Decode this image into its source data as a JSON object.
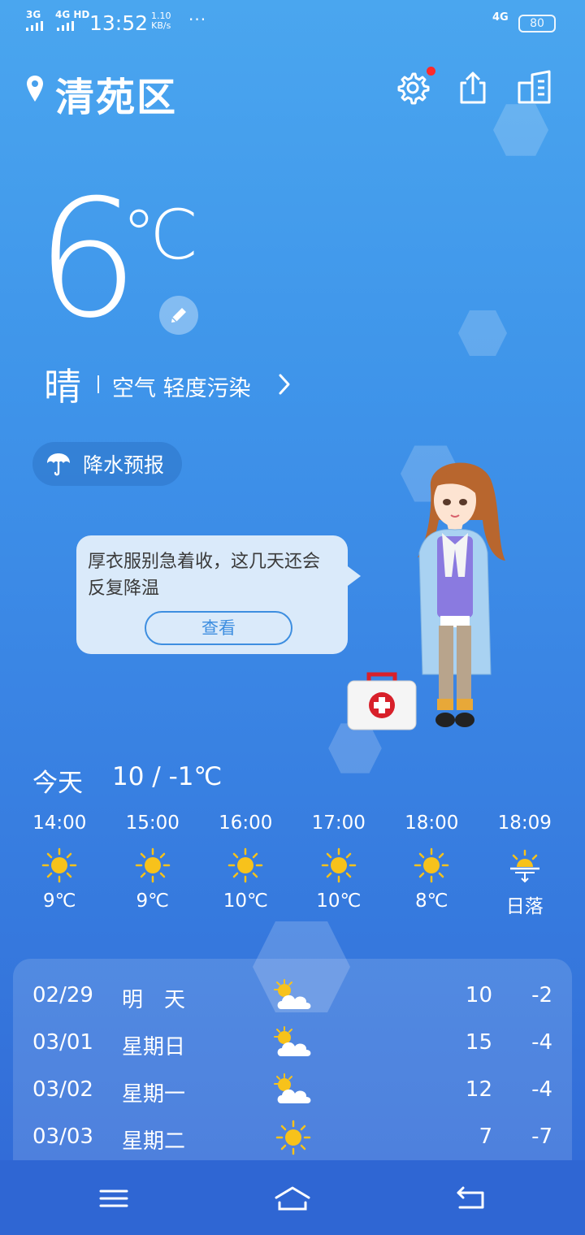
{
  "status_bar": {
    "signal1": "3G",
    "signal2": "4G HD",
    "time": "13:52",
    "speed_value": "1.10",
    "speed_unit": "KB/s",
    "more": "···",
    "network": "4G",
    "battery": "80"
  },
  "header": {
    "location": "清苑区",
    "settings_icon": "gear-icon",
    "share_icon": "share-icon",
    "cities_icon": "buildings-icon"
  },
  "current": {
    "temperature": "6",
    "unit": "℃",
    "condition": "晴",
    "air_quality": "空气 轻度污染"
  },
  "rain_button": {
    "label": "降水预报"
  },
  "tip": {
    "text": "厚衣服别急着收，这几天还会反复降温",
    "button": "查看"
  },
  "today": {
    "label": "今天",
    "range": "10 / -1℃"
  },
  "hourly": [
    {
      "time": "14:00",
      "icon": "sun-icon",
      "value": "9℃"
    },
    {
      "time": "15:00",
      "icon": "sun-icon",
      "value": "9℃"
    },
    {
      "time": "16:00",
      "icon": "sun-icon",
      "value": "10℃"
    },
    {
      "time": "17:00",
      "icon": "sun-icon",
      "value": "10℃"
    },
    {
      "time": "18:00",
      "icon": "sun-icon",
      "value": "8℃"
    },
    {
      "time": "18:09",
      "icon": "sunset-icon",
      "value": "日落"
    }
  ],
  "forecast": [
    {
      "date": "02/29",
      "weekday": "明　天",
      "icon": "partly-cloudy-icon",
      "high": "10",
      "low": "-2"
    },
    {
      "date": "03/01",
      "weekday": "星期日",
      "icon": "partly-cloudy-icon",
      "high": "15",
      "low": "-4"
    },
    {
      "date": "03/02",
      "weekday": "星期一",
      "icon": "partly-cloudy-icon",
      "high": "12",
      "low": "-4"
    },
    {
      "date": "03/03",
      "weekday": "星期二",
      "icon": "sun-icon",
      "high": "7",
      "low": "-7"
    }
  ],
  "colors": {
    "accent": "#3d8ee0",
    "sun": "#f7c21b",
    "badge": "#ff2a2a"
  }
}
